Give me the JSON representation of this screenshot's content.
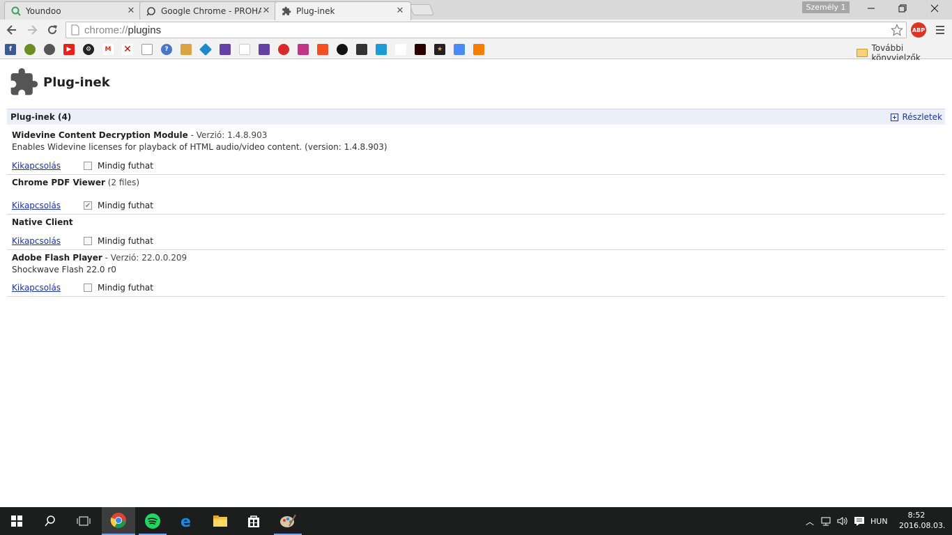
{
  "window": {
    "tabs": [
      {
        "title": "Youndoo",
        "icon": "youndoo-q-icon"
      },
      {
        "title": "Google Chrome - PROHARDVER!",
        "icon": "prohardver-icon"
      },
      {
        "title": "Plug-inek",
        "icon": "puzzle-icon"
      }
    ],
    "profile_label": "Személy 1"
  },
  "toolbar": {
    "url_scheme": "chrome://",
    "url_path": "plugins",
    "abp_label": "ABP"
  },
  "bookmarks": {
    "other_label": "További könyvjelzők",
    "items": [
      "f",
      "",
      "",
      "",
      "",
      "M",
      "",
      "",
      "",
      "?",
      "",
      "",
      "",
      "",
      "",
      "",
      "",
      "",
      "",
      "",
      "",
      "",
      "",
      "",
      "",
      "",
      "",
      "",
      "",
      ""
    ]
  },
  "page": {
    "title": "Plug-inek",
    "section_title": "Plug-inek (4)",
    "details_label": "Részletek",
    "plugins": [
      {
        "name": "Widevine Content Decryption Module",
        "version": " - Verzió: 1.4.8.903",
        "description": "Enables Widevine licenses for playback of HTML audio/video content. (version: 1.4.8.903)",
        "disable_label": "Kikapcsolás",
        "always_run_label": "Mindig futhat",
        "always_run": false
      },
      {
        "name": "Chrome PDF Viewer",
        "version": " (2 files)",
        "description": "",
        "disable_label": "Kikapcsolás",
        "always_run_label": "Mindig futhat",
        "always_run": true
      },
      {
        "name": "Native Client",
        "version": "",
        "description": "",
        "disable_label": "Kikapcsolás",
        "always_run_label": "Mindig futhat",
        "always_run": false
      },
      {
        "name": "Adobe Flash Player",
        "version": " - Verzió: 22.0.0.209",
        "description": "Shockwave Flash 22.0 r0",
        "disable_label": "Kikapcsolás",
        "always_run_label": "Mindig futhat",
        "always_run": false
      }
    ]
  },
  "taskbar": {
    "language": "HUN",
    "time": "8:52",
    "date": "2016.08.03."
  }
}
